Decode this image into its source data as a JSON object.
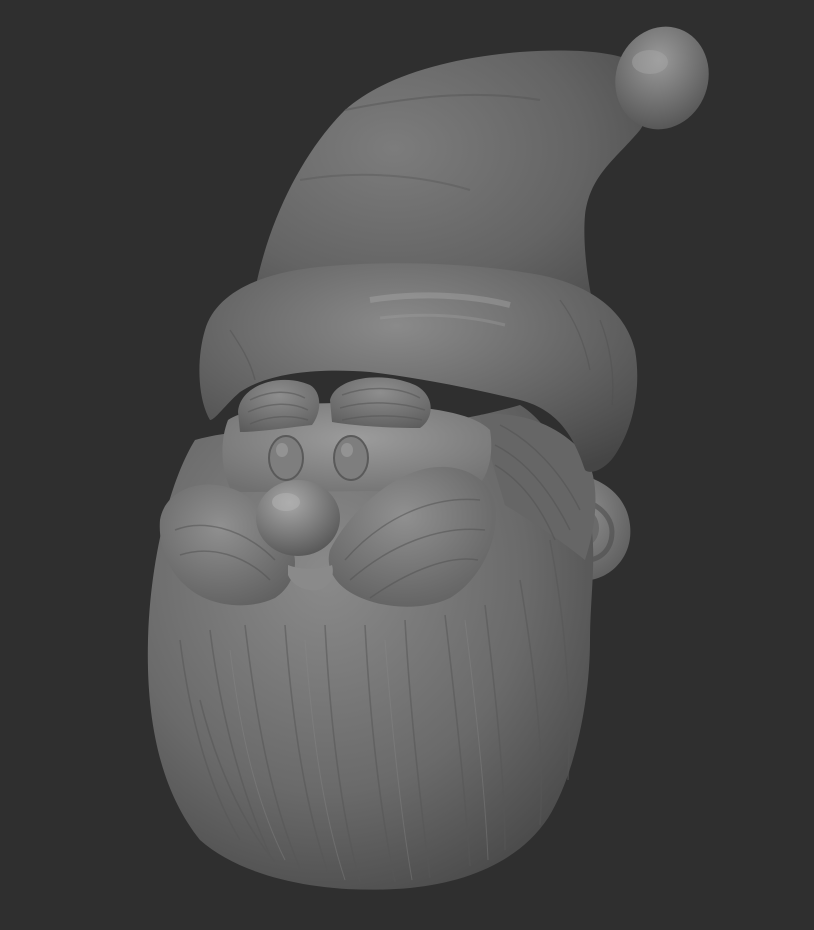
{
  "scene": {
    "subject": "santa-gnome-head-sculpt",
    "background_color": "#2f2f2f",
    "material_color": "#6e6e6e",
    "highlight_color": "#a9a9a9",
    "shadow_color": "#3a3a3a",
    "elements": [
      "hat",
      "pom-pom",
      "hat-brim",
      "eyebrows",
      "eyes",
      "nose",
      "mustache",
      "beard",
      "ear"
    ]
  }
}
